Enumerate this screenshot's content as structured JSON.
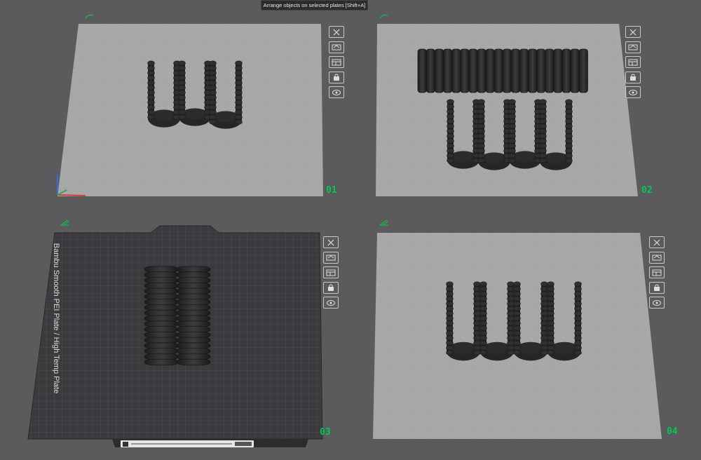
{
  "tooltip": {
    "text": "Arrange objects on selected plates [Shift+A]"
  },
  "plates": [
    {
      "number": "01",
      "selected": false
    },
    {
      "number": "02",
      "selected": false
    },
    {
      "number": "03",
      "selected": true,
      "bed_name": "Bambu Smooth PEI Plate / High Temp Plate"
    },
    {
      "number": "04",
      "selected": false
    }
  ],
  "plate_tools": [
    "close-icon",
    "auto-orient-icon",
    "arrange-icon",
    "lock-icon",
    "settings-icon"
  ],
  "colors": {
    "background": "#5b5b5e",
    "plate_surface": "#a6a6a8",
    "selected_surface": "#3a3a3d",
    "plate_number": "#00c853",
    "model": "#2a2a2a"
  }
}
